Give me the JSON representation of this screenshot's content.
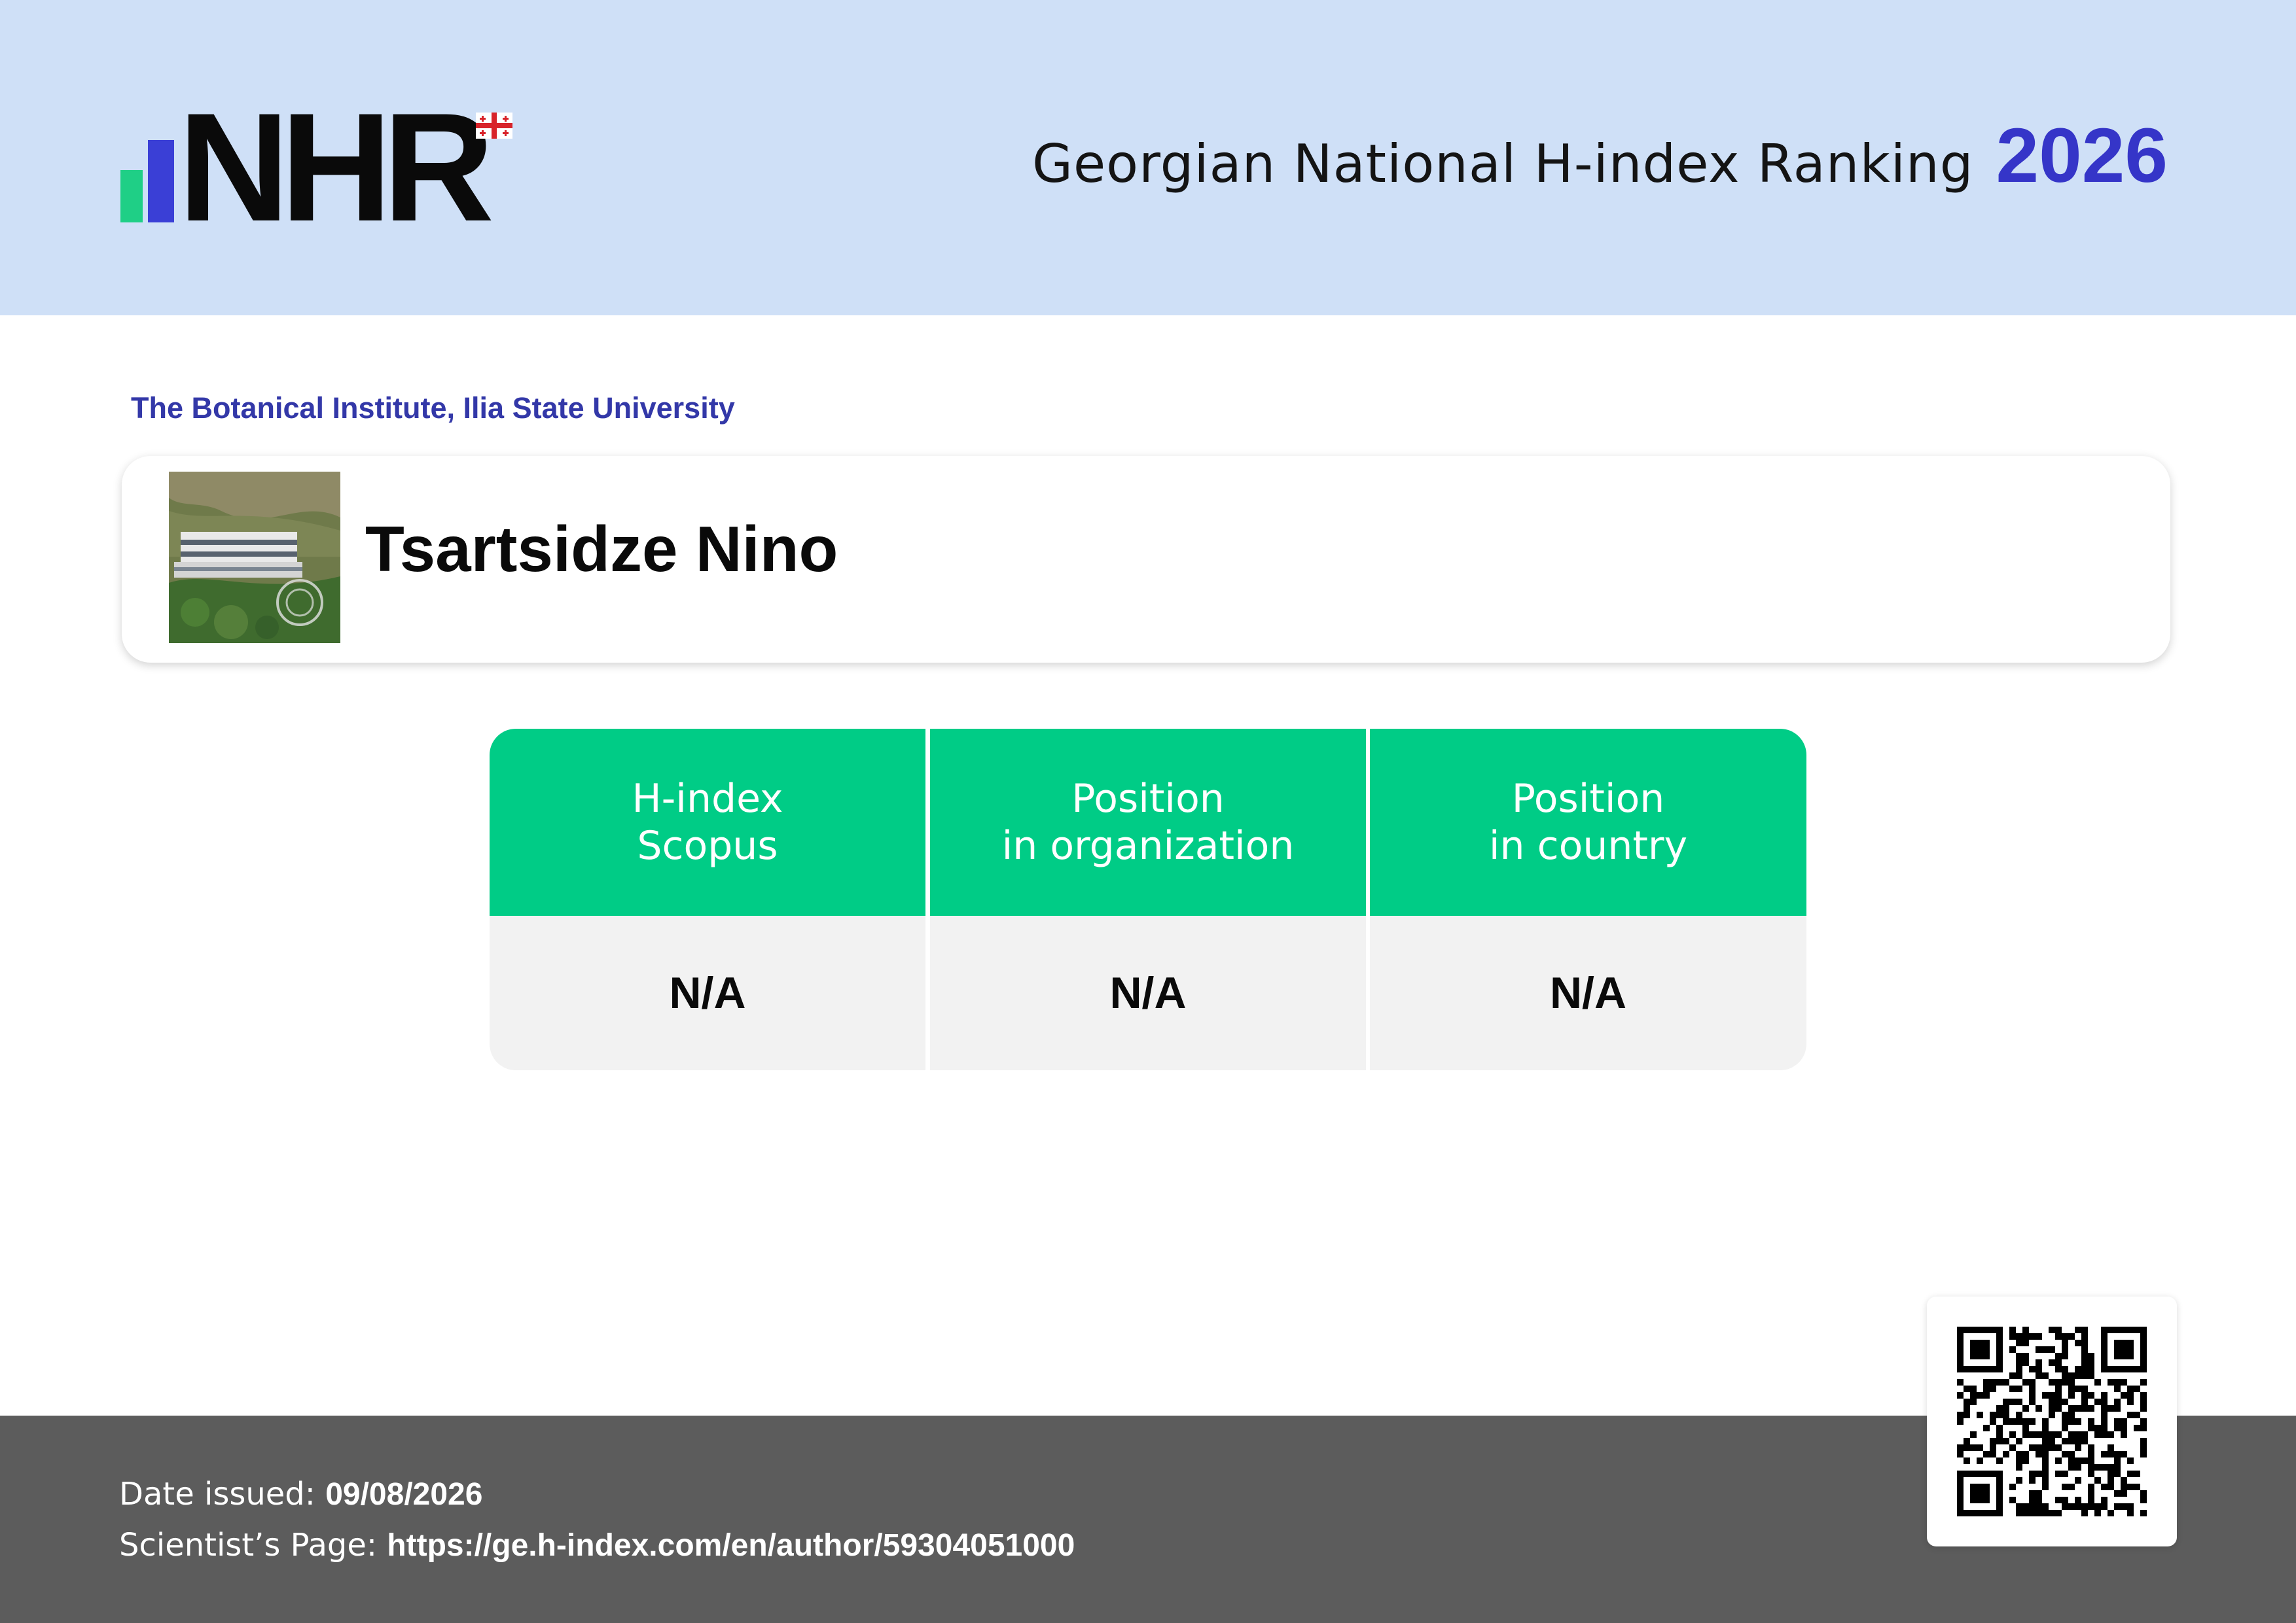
{
  "header": {
    "logo_text": "NHR",
    "title": "Georgian National H-index Ranking",
    "year": "2026"
  },
  "organization": "The Botanical Institute, Ilia State University",
  "scientist": {
    "name": "Tsartsidze Nino"
  },
  "stats": {
    "columns": [
      {
        "line1": "H-index",
        "line2": "Scopus",
        "value": "N/A"
      },
      {
        "line1": "Position",
        "line2": "in organization",
        "value": "N/A"
      },
      {
        "line1": "Position",
        "line2": "in country",
        "value": "N/A"
      }
    ]
  },
  "footer": {
    "date_label": "Date issued:",
    "date_value": "09/08/2026",
    "page_label": "Scientist’s Page:",
    "page_url": "https://ge.h-index.com/en/author/59304051000"
  },
  "colors": {
    "header_bg": "#cfe0f7",
    "accent_blue": "#3535c8",
    "accent_green": "#00cc86",
    "footer_bg": "#5c5c5c"
  }
}
